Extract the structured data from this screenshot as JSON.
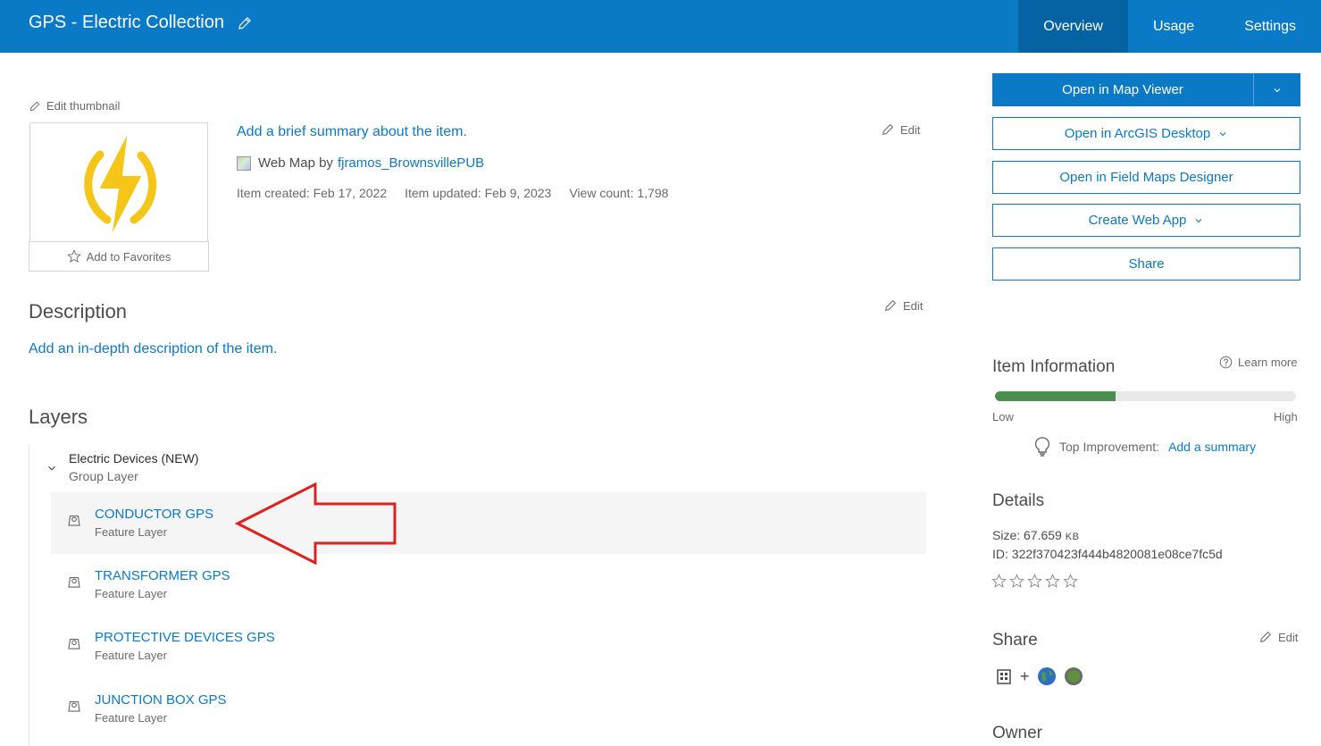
{
  "header": {
    "title": "GPS - Electric Collection",
    "tabs": [
      {
        "label": "Overview",
        "active": true
      },
      {
        "label": "Usage",
        "active": false
      },
      {
        "label": "Settings",
        "active": false
      }
    ],
    "color": "#0a7ac7"
  },
  "thumbnail": {
    "edit_label": "Edit thumbnail",
    "favorites_label": "Add to Favorites",
    "icon": "lightning-bolt-icon",
    "icon_color": "#f5c518"
  },
  "summary": {
    "add_summary": "Add a brief summary about the item.",
    "type_text": "Web Map by",
    "owner": "fjramos_BrownsvillePUB",
    "created": "Item created: Feb 17, 2022",
    "updated": "Item updated: Feb 9, 2023",
    "views": "View count: 1,798",
    "edit_label": "Edit"
  },
  "description": {
    "heading": "Description",
    "add_link": "Add an in-depth description of the item.",
    "edit_label": "Edit"
  },
  "layers": {
    "heading": "Layers",
    "group": {
      "name": "Electric Devices (NEW)",
      "type": "Group Layer"
    },
    "items": [
      {
        "name": "CONDUCTOR GPS",
        "type": "Feature Layer",
        "selected": true
      },
      {
        "name": "TRANSFORMER GPS",
        "type": "Feature Layer",
        "selected": false
      },
      {
        "name": "PROTECTIVE DEVICES GPS",
        "type": "Feature Layer",
        "selected": false
      },
      {
        "name": "JUNCTION BOX GPS",
        "type": "Feature Layer",
        "selected": false
      }
    ]
  },
  "actions": {
    "open_map_viewer": "Open in Map Viewer",
    "open_desktop": "Open in ArcGIS Desktop",
    "open_field_maps": "Open in Field Maps Designer",
    "create_web_app": "Create Web App",
    "share": "Share"
  },
  "item_information": {
    "heading": "Item Information",
    "learn_more": "Learn more",
    "progress": 0.4,
    "low": "Low",
    "high": "High",
    "improvement_label": "Top Improvement:",
    "improvement_link": "Add a summary"
  },
  "details": {
    "heading": "Details",
    "size_label": "Size: 67.659",
    "size_unit": "KB",
    "id": "ID: 322f370423f444b4820081e08ce7fc5d",
    "rating": 0
  },
  "share_section": {
    "heading": "Share",
    "edit_label": "Edit",
    "plus": "+"
  },
  "owner": {
    "heading": "Owner"
  }
}
